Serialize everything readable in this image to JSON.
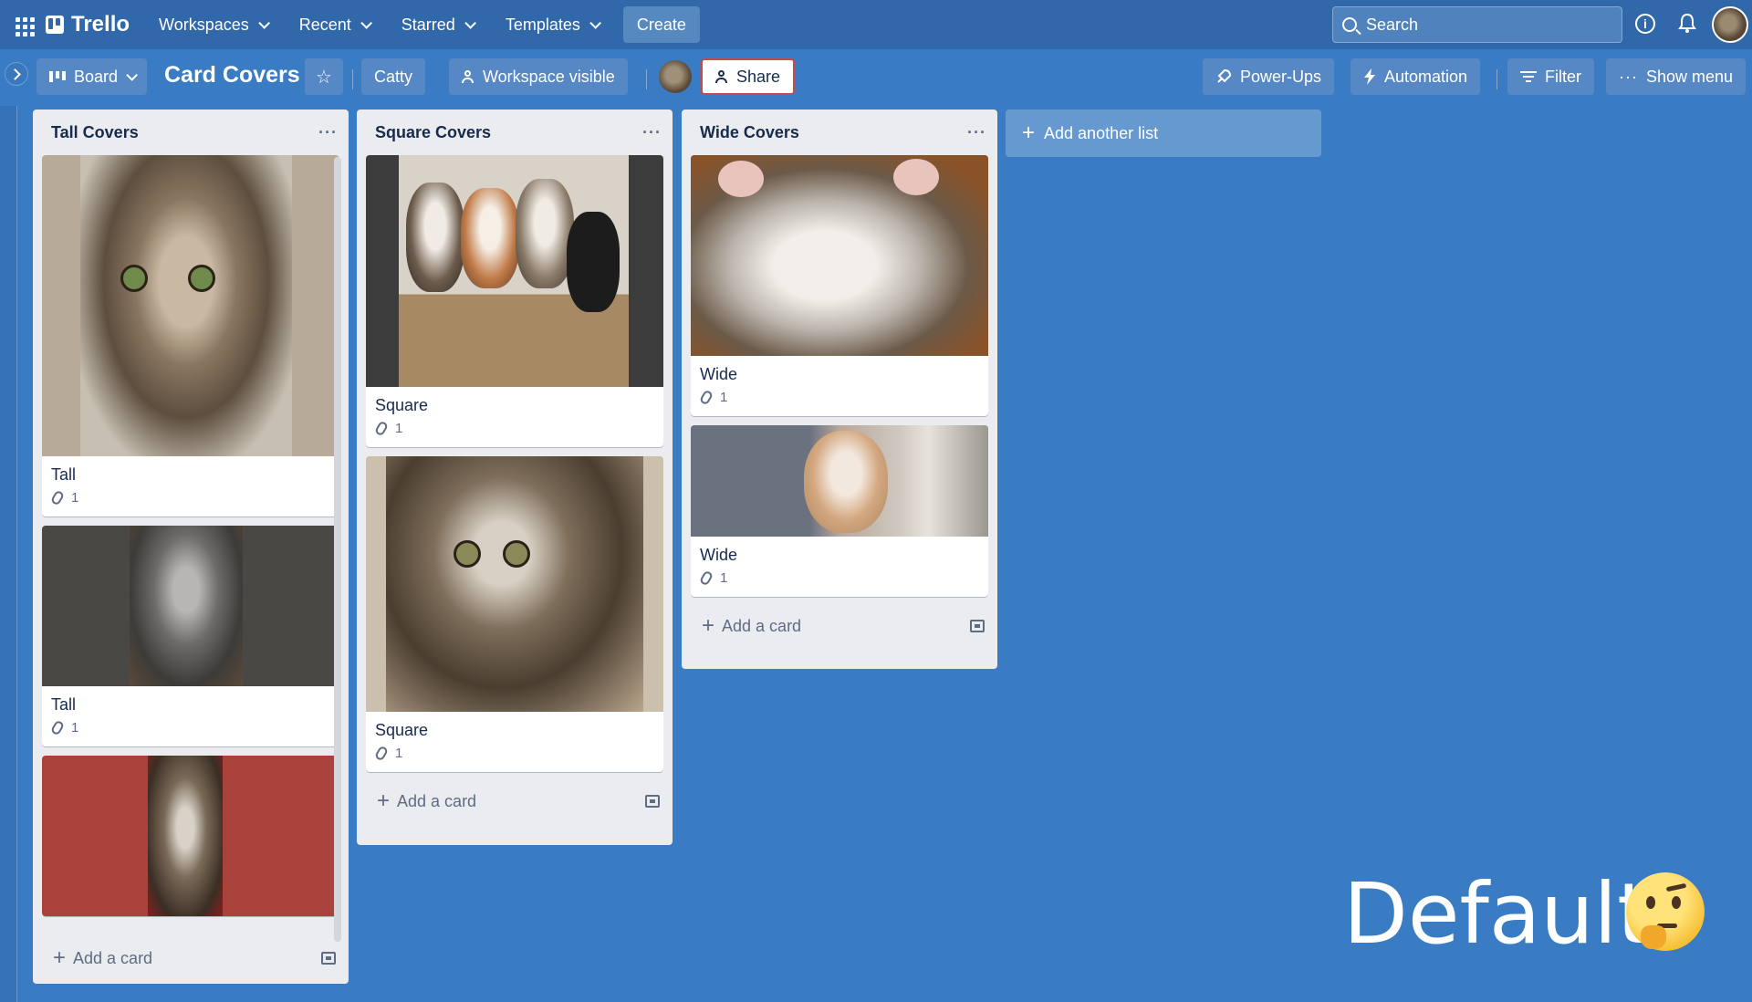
{
  "nav": {
    "app_name": "Trello",
    "workspaces": "Workspaces",
    "recent": "Recent",
    "starred": "Starred",
    "templates": "Templates",
    "create": "Create",
    "search_placeholder": "Search"
  },
  "board": {
    "view": "Board",
    "title": "Card Covers",
    "workspace": "Catty",
    "visibility": "Workspace visible",
    "share": "Share",
    "power_ups": "Power-Ups",
    "automation": "Automation",
    "filter": "Filter",
    "show_menu": "Show menu"
  },
  "lists": [
    {
      "title": "Tall Covers",
      "cards": [
        {
          "title": "Tall",
          "attachments": "1"
        },
        {
          "title": "Tall",
          "attachments": "1"
        },
        {
          "title": "",
          "attachments": ""
        }
      ],
      "add_card": "Add a card"
    },
    {
      "title": "Square Covers",
      "cards": [
        {
          "title": "Square",
          "attachments": "1"
        },
        {
          "title": "Square",
          "attachments": "1"
        }
      ],
      "add_card": "Add a card"
    },
    {
      "title": "Wide Covers",
      "cards": [
        {
          "title": "Wide",
          "attachments": "1"
        },
        {
          "title": "Wide",
          "attachments": "1"
        }
      ],
      "add_card": "Add a card"
    }
  ],
  "add_list": "Add another list",
  "overlay_text": "Default",
  "colors": {
    "board_bg": "#3a7cc3",
    "nav_bg": "#3068a9",
    "list_bg": "#ebecf0",
    "cover_red": "#a8423a",
    "cover_dark": "#4a4845"
  }
}
